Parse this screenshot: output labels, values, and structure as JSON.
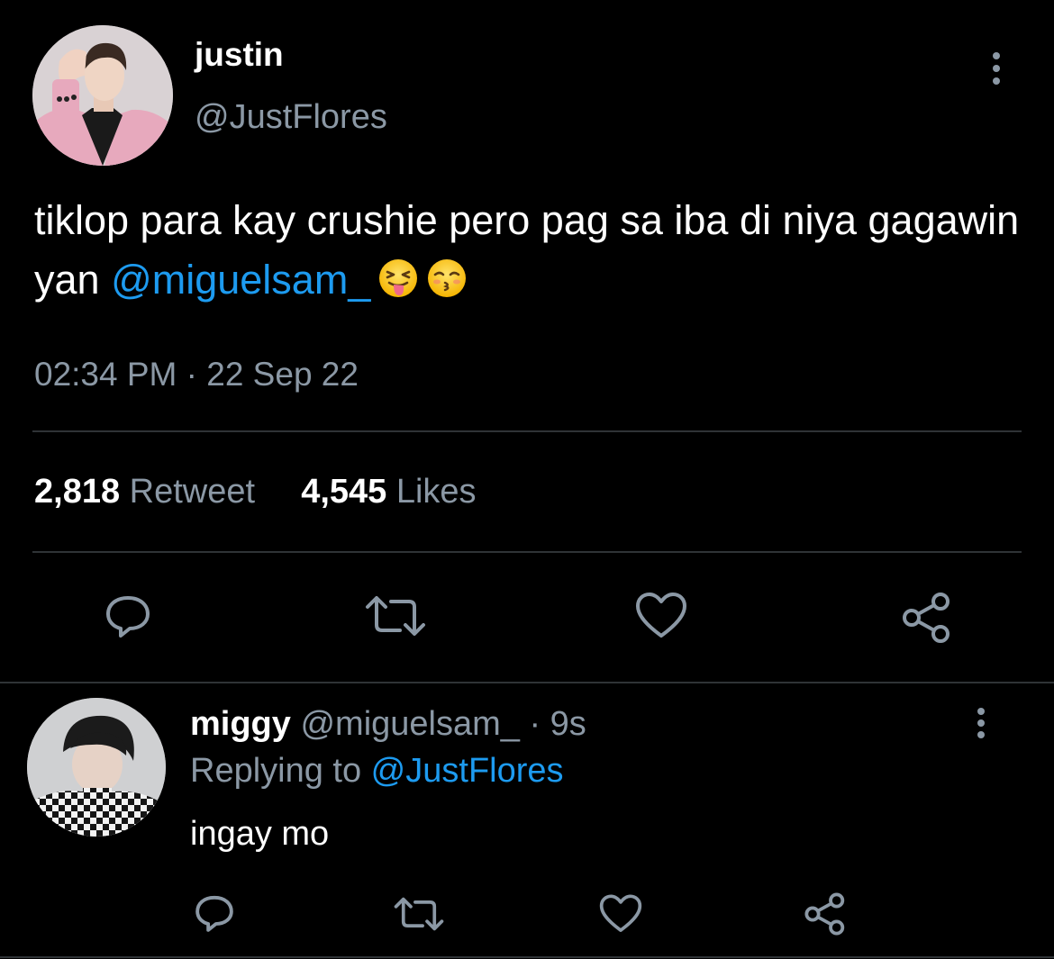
{
  "tweet": {
    "author_name": "justin",
    "author_handle": "@JustFlores",
    "text_part1": "tiklop para kay crushie pero pag sa iba di niya gagawin yan ",
    "mention": "@miguelsam_",
    "emojis": [
      "squinting-face-with-tongue",
      "kissing-face-with-closed-eyes"
    ],
    "timestamp": "02:34 PM · 22 Sep 22",
    "retweet_count": "2,818",
    "retweet_label": "Retweet",
    "like_count": "4,545",
    "like_label": "Likes",
    "actions": [
      "reply-icon",
      "retweet-icon",
      "like-icon",
      "share-icon"
    ]
  },
  "reply": {
    "author_name": "miggy",
    "author_handle": "@miguelsam_",
    "time": " · 9s",
    "replying_label": "Replying to ",
    "replying_handle": "@JustFlores",
    "text": "ingay mo",
    "actions": [
      "reply-icon",
      "retweet-icon",
      "like-icon",
      "share-icon"
    ]
  },
  "colors": {
    "background": "#000000",
    "text": "#ffffff",
    "secondary": "#8b98a5",
    "accent": "#1d9bf0",
    "divider": "#2f3336"
  }
}
